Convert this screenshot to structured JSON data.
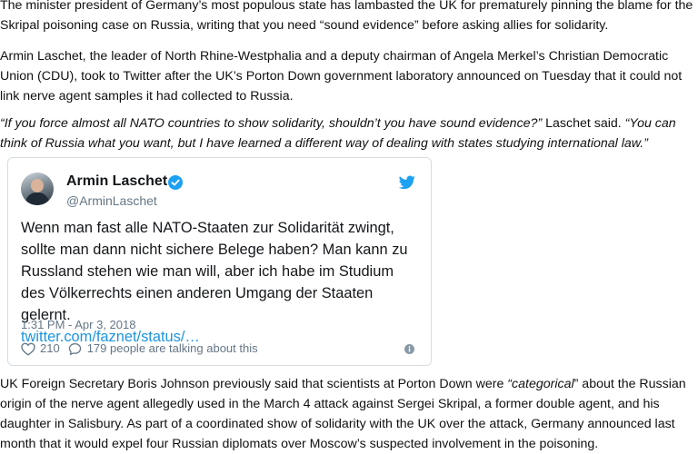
{
  "article": {
    "p1": "The minister president of Germany’s most populous state has lambasted the UK for prematurely pinning the blame for the Skripal poisoning case on Russia, writing that you need “sound evidence” before asking allies for solidarity.",
    "p2": "Armin Laschet, the leader of North Rhine-Westphalia and a deputy chairman of Angela Merkel’s Christian Democratic Union (CDU), took to Twitter after the UK’s Porton Down government laboratory announced on Tuesday that it could not link nerve agent samples it had collected to Russia.",
    "p3_quote1": "“If you force almost all NATO countries to show solidarity, shouldn’t you have sound evidence?”",
    "p3_mid": " Laschet said. ",
    "p3_quote2": "“You can think of Russia what you want, but I have learned a different way of dealing with states studying international law.”",
    "p4_start": "UK Foreign Secretary Boris Johnson previously said that scientists at Porton Down were ",
    "p4_em": "“categorical",
    "p4_rest": "” about the Russian origin of the nerve agent allegedly used in the March 4 attack against Sergei Skripal, a former double agent, and his daughter in Salisbury. As part of a coordinated show of solidarity with the UK over the attack, Germany announced last month that it would expel four Russian diplomats over Moscow’s suspected involvement in the poisoning."
  },
  "tweet": {
    "name": "Armin Laschet",
    "handle": "@ArminLaschet",
    "text": "Wenn man fast alle NATO-Staaten zur Solidarität zwingt, sollte man dann nicht sichere Belege haben? Man kann zu Russland stehen wie man will, aber ich habe im Studium des Völkerrechts einen anderen Umgang der Staaten gelernt.",
    "link": "twitter.com/faznet/status/…",
    "time": "1:31 PM - Apr 3, 2018",
    "likes": "210",
    "talking": "179 people are talking about this",
    "colors": {
      "accent": "#1da1f2",
      "link": "#1b95e0",
      "muted": "#657786",
      "border": "#d7dde3"
    }
  }
}
